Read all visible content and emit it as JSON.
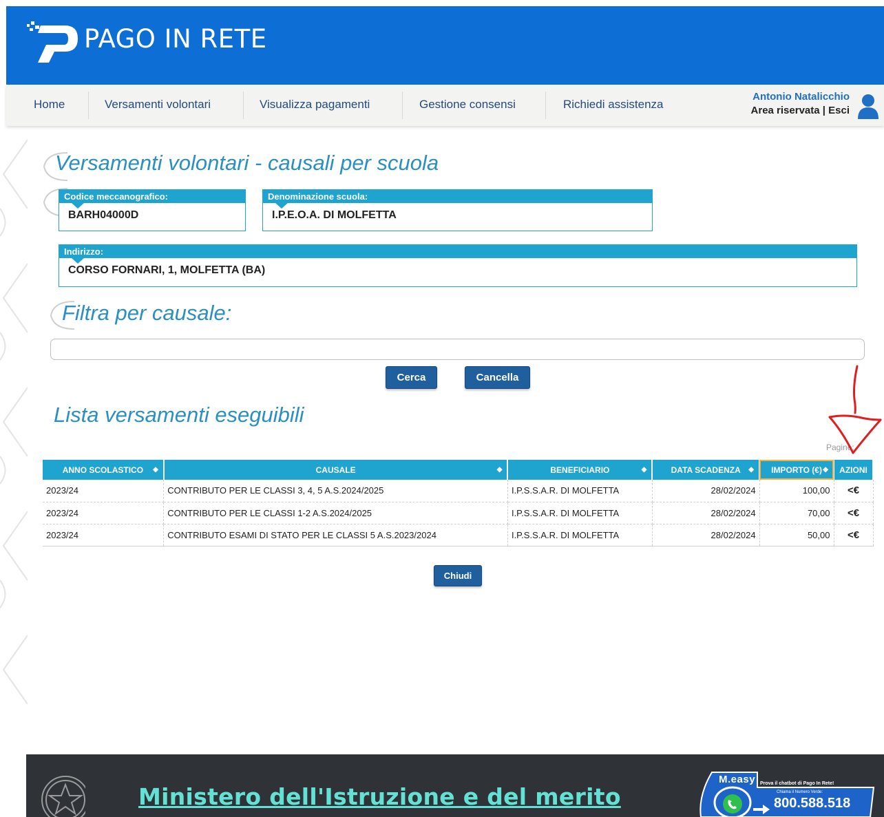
{
  "brand": {
    "title": "PAGO IN RETE"
  },
  "nav": {
    "items": [
      "Home",
      "Versamenti volontari",
      "Visualizza pagamenti",
      "Gestione consensi",
      "Richiedi assistenza"
    ],
    "user_name": "Antonio Natalicchio",
    "user_links": "Area riservata | Esci"
  },
  "page": {
    "title": "Versamenti volontari - causali per scuola",
    "codice_label": "Codice meccanografico:",
    "codice_value": "BARH04000D",
    "denominazione_label": "Denominazione scuola:",
    "denominazione_value": "I.P.E.O.A. DI MOLFETTA",
    "indirizzo_label": "Indirizzo:",
    "indirizzo_value": "CORSO FORNARI, 1, MOLFETTA (BA)",
    "filter_title": "Filtra per causale:",
    "filter_value": "",
    "search_label": "Cerca",
    "cancel_label": "Cancella",
    "list_title": "Lista versamenti eseguibili",
    "pager_label": "Pagine:",
    "close_label": "Chiudi"
  },
  "table": {
    "headers": [
      "ANNO SCOLASTICO",
      "CAUSALE",
      "BENEFICIARIO",
      "DATA SCADENZA",
      "IMPORTO (€)",
      "AZIONI"
    ],
    "rows": [
      [
        "2023/24",
        "CONTRIBUTO PER LE CLASSI 3, 4, 5 A.S.2024/2025",
        "I.P.S.S.A.R. DI MOLFETTA",
        "28/02/2024",
        "100,00",
        "<€"
      ],
      [
        "2023/24",
        "CONTRIBUTO PER LE CLASSI 1-2 A.S.2024/2025",
        "I.P.S.S.A.R. DI MOLFETTA",
        "28/02/2024",
        "70,00",
        "<€"
      ],
      [
        "2023/24",
        "CONTRIBUTO ESAMI DI STATO PER LE CLASSI 5 A.S.2023/2024",
        "I.P.S.S.A.R. DI MOLFETTA",
        "28/02/2024",
        "50,00",
        "<€"
      ]
    ]
  },
  "footer": {
    "ministry": "Ministero dell'Istruzione e del merito",
    "chatbot_name": "M.easy",
    "chatbot_text": "Prova il chatbot di Pago In Rete!",
    "phone_label": "Chiama il Numero Verde:",
    "phone_number": "800.588.518"
  },
  "colors": {
    "brand": "#0d6fd6",
    "accent": "#1ea4cf",
    "button": "#1f5f9e",
    "footer": "#2f3337",
    "annotation": "#e11d1d"
  },
  "icons": [
    "pago-logo-icon",
    "user-icon",
    "sort-icon",
    "pay-action-icon",
    "republic-emblem-icon",
    "phone-icon"
  ]
}
